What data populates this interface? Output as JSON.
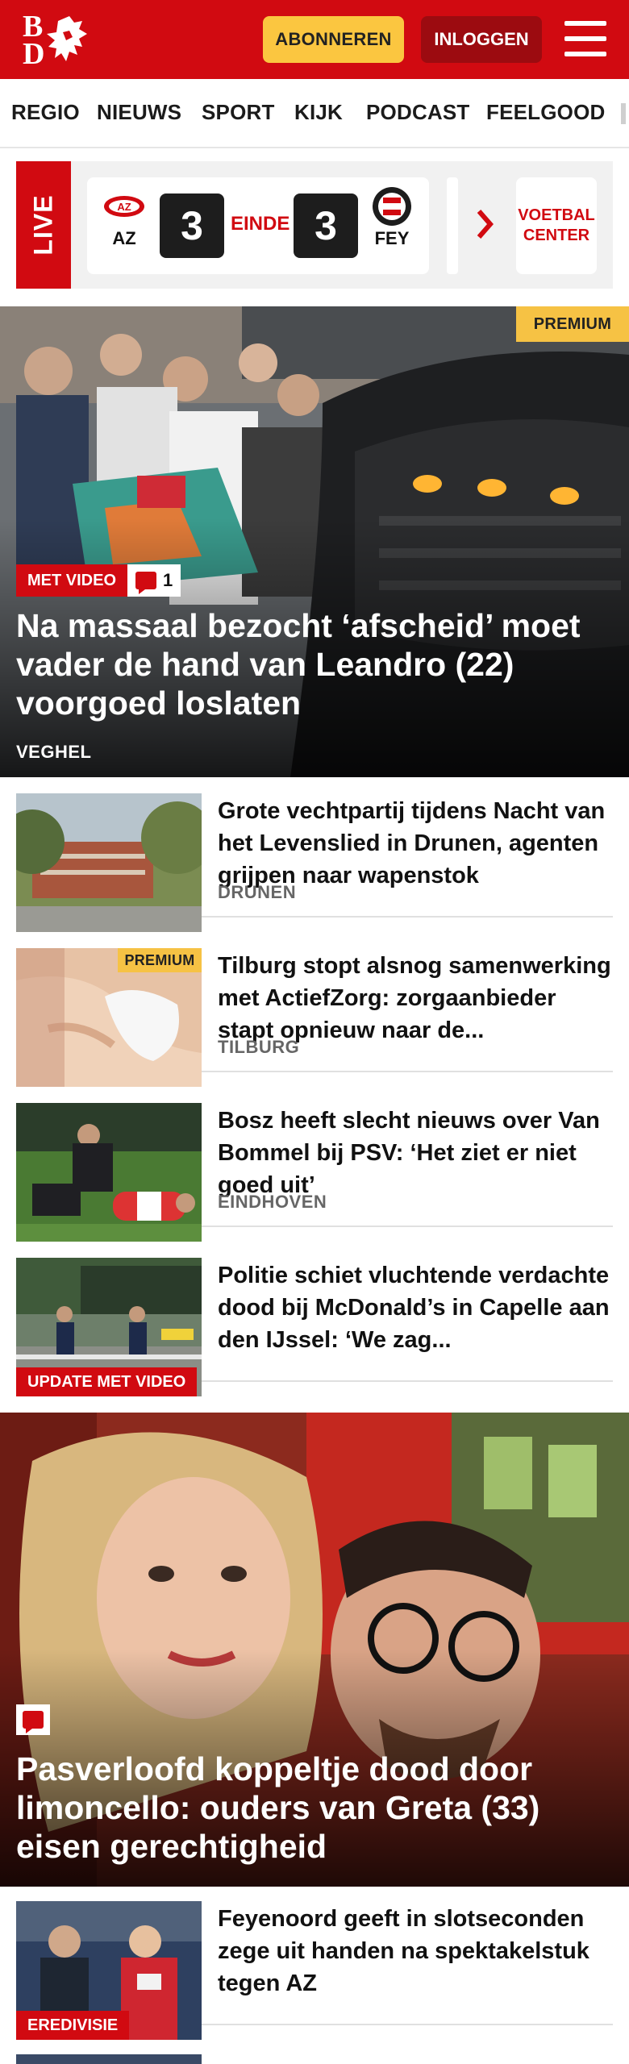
{
  "header": {
    "logo_letters": [
      "B",
      "D"
    ],
    "subscribe_label": "ABONNEREN",
    "login_label": "INLOGGEN",
    "accent_color": "#d10a11",
    "subscribe_color": "#fbc640"
  },
  "nav": {
    "items": [
      "REGIO",
      "NIEUWS",
      "SPORT",
      "KIJK",
      "PODCAST",
      "FEELGOOD"
    ]
  },
  "live": {
    "label": "LIVE",
    "home_team": "AZ",
    "home_score": "3",
    "status": "EINDE",
    "away_score": "3",
    "away_team": "FEY",
    "more_line1": "VOETBAL",
    "more_line2": "CENTER"
  },
  "hero": {
    "badge": "PREMIUM",
    "video_tag": "MET VIDEO",
    "comment_count": "1",
    "title": "Na massaal bezocht ‘afscheid’ moet vader de hand van Leandro (22) voorgoed loslaten",
    "location": "VEGHEL"
  },
  "articles": [
    {
      "title": "Grote vechtpartij tijdens Nacht van het Levenslied in Drunen, agenten grijpen naar wapenstok",
      "location": "DRUNEN"
    },
    {
      "badge": "PREMIUM",
      "title": "Tilburg stopt alsnog samenwer­king met ActiefZorg: zorgaanbie­der stapt opnieuw naar de...",
      "location": "TILBURG"
    },
    {
      "title": "Bosz heeft slecht nieuws over Van Bommel bij PSV: ‘Het ziet er niet goed uit’",
      "location": "EINDHOVEN"
    },
    {
      "tag": "UPDATE MET VIDEO",
      "title": "Politie schiet vluchtende verdachte dood bij McDonald’s in Capelle aan den IJssel: ‘We zag...",
      "location": ""
    }
  ],
  "hero2": {
    "title": "Pasverloofd koppeltje dood door limoncello: ouders van Greta (33) eisen gerechtigheid"
  },
  "article5": {
    "tag": "EREDIVISIE",
    "title": "Feyenoord geeft in slotseconden zege uit handen na spektakel­stuk tegen AZ"
  }
}
